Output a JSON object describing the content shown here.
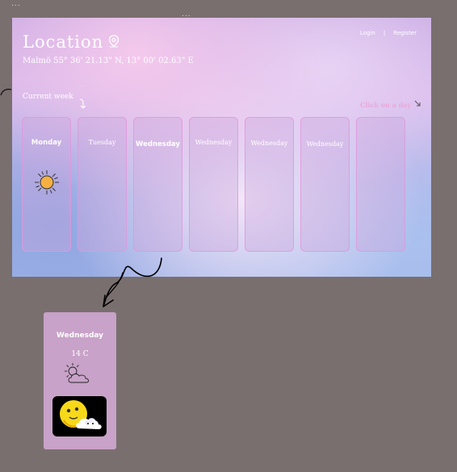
{
  "page": {
    "dots_top": "...",
    "dots_hero": "...",
    "dots_week": "..."
  },
  "header": {
    "title": "Location",
    "coordinates": "Malmö 55° 36' 21.13\" N, 13° 00' 02.63\" E",
    "login_label": "Login",
    "separator": "|",
    "register_label": "Register"
  },
  "week": {
    "label": "Current week",
    "click_label": "Click on a day",
    "days": [
      {
        "name": "Monday",
        "icon": "sun-icon"
      },
      {
        "name": "Tuesday"
      },
      {
        "name": "Wednesday"
      },
      {
        "name": "Wednesday"
      },
      {
        "name": "Wednesday"
      },
      {
        "name": "Wednesday"
      },
      {
        "name": ""
      }
    ]
  },
  "detail_card": {
    "day": "Wednesday",
    "temperature": "14 C",
    "icon": "partly-cloudy-icon",
    "animation": "sun-cloud-animation"
  },
  "colors": {
    "background": "#7a6f6f",
    "card": "#c8a2c8",
    "day_border": "#e296dc",
    "click_label": "#e9a9da"
  }
}
